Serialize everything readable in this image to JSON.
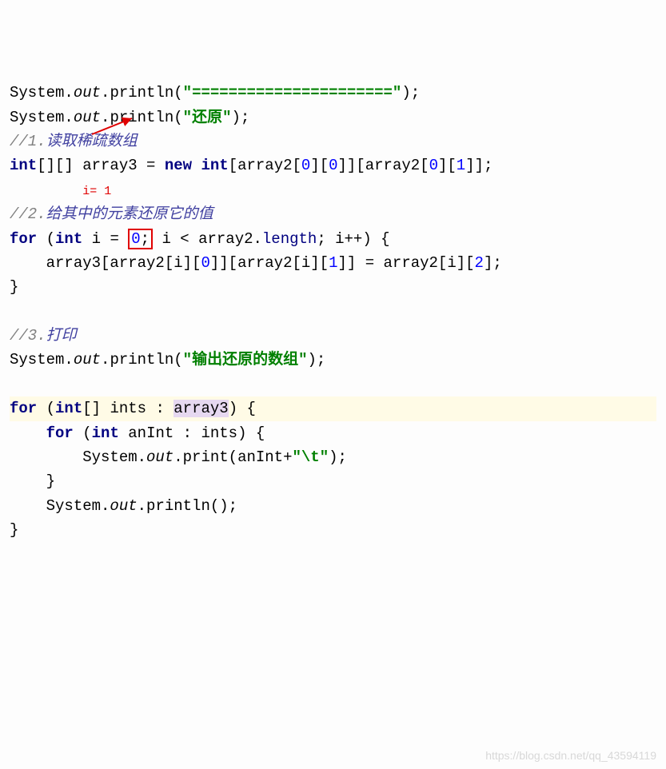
{
  "lines": {
    "l1_pre": "System.",
    "l1_out": "out",
    "l1_mid": ".println(",
    "l1_str": "\"======================\"",
    "l1_end": ");",
    "l2_pre": "System.",
    "l2_out": "out",
    "l2_mid": ".println(",
    "l2_str": "\"还原\"",
    "l2_end": ");",
    "c1_pre": "//1.",
    "c1_txt": "读取稀疏数组",
    "l4_kw1": "int",
    "l4_a": "[][] array3 = ",
    "l4_kw2": "new int",
    "l4_b": "[array2[",
    "l4_n0a": "0",
    "l4_c": "][",
    "l4_n0b": "0",
    "l4_d": "]][array2[",
    "l4_n0c": "0",
    "l4_e": "][",
    "l4_n1": "1",
    "l4_f": "]];",
    "ann_i": "i= 1",
    "c2_pre": "//2.",
    "c2_txt": "给其中的元素还原它的值",
    "l6_for": "for",
    "l6_a": " (",
    "l6_int": "int",
    "l6_b": " i = ",
    "l6_zero": "0",
    "l6_semi": ";",
    "l6_c": " i < array2.",
    "l6_len": "length",
    "l6_d": "; i++) {",
    "l7": "    array3[array2[i][",
    "l7_n0": "0",
    "l7_m": "]][array2[i][",
    "l7_n1": "1",
    "l7_m2": "]] = array2[i][",
    "l7_n2": "2",
    "l7_e": "];",
    "l8": "}",
    "c3_pre": "//3.",
    "c3_txt": "打印",
    "l10_pre": "System.",
    "l10_out": "out",
    "l10_mid": ".println(",
    "l10_str": "\"输出还原的数组\"",
    "l10_end": ");",
    "l12_for": "for",
    "l12_a": " (",
    "l12_int": "int",
    "l12_b": "[] ints : ",
    "l12_arr": "array3",
    "l12_c": ") {",
    "l13_pre": "    ",
    "l13_for": "for",
    "l13_a": " (",
    "l13_int": "int",
    "l13_b": " anInt : ints) {",
    "l14_pre": "        System.",
    "l14_out": "out",
    "l14_mid": ".print(anInt+",
    "l14_str": "\"\\t\"",
    "l14_end": ");",
    "l15": "    }",
    "l16_pre": "    System.",
    "l16_out": "out",
    "l16_end": ".println();",
    "l17": "}"
  },
  "watermark": "https://blog.csdn.net/qq_43594119"
}
